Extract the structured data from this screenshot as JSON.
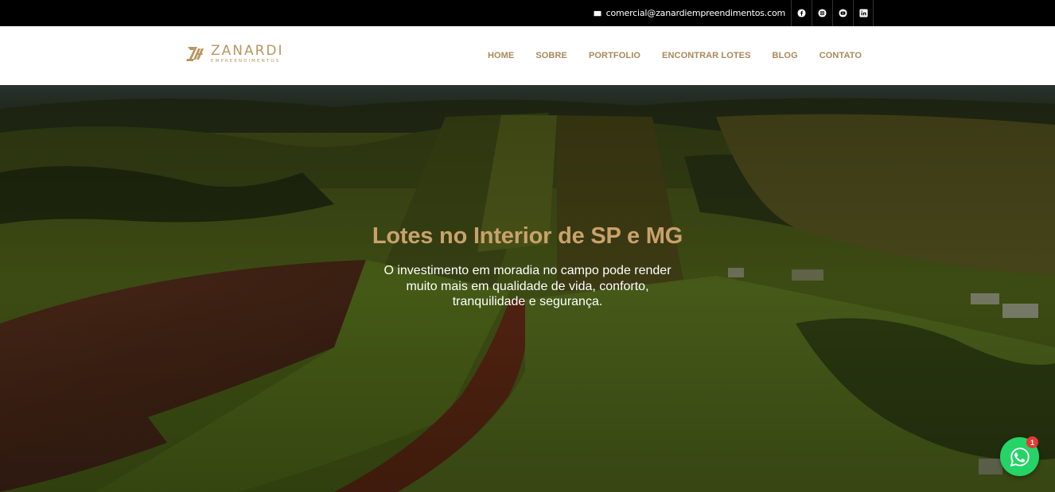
{
  "topbar": {
    "email": "comercial@zanardiempreendimentos.com",
    "social": [
      {
        "icon": "facebook-icon"
      },
      {
        "icon": "instagram-icon"
      },
      {
        "icon": "youtube-icon"
      },
      {
        "icon": "linkedin-icon"
      }
    ]
  },
  "header": {
    "logo_name": "ZANARDI",
    "logo_sub": "EMPREENDIMENTOS",
    "nav": [
      "HOME",
      "SOBRE",
      "PORTFOLIO",
      "ENCONTRAR LOTES",
      "BLOG",
      "CONTATO"
    ]
  },
  "hero": {
    "title": "Lotes no Interior de SP e MG",
    "subtitle": "O investimento em moradia no campo pode render muito mais em qualidade de vida, conforto, tranquilidade e segurança."
  },
  "whatsapp": {
    "badge": "1"
  },
  "colors": {
    "brand_gold": "#b89560",
    "nav_gold": "#a9885a",
    "title_gold": "#c9a26b",
    "topbar_bg": "#000000",
    "whatsapp_green": "#25d366",
    "badge_red": "#e53935"
  }
}
